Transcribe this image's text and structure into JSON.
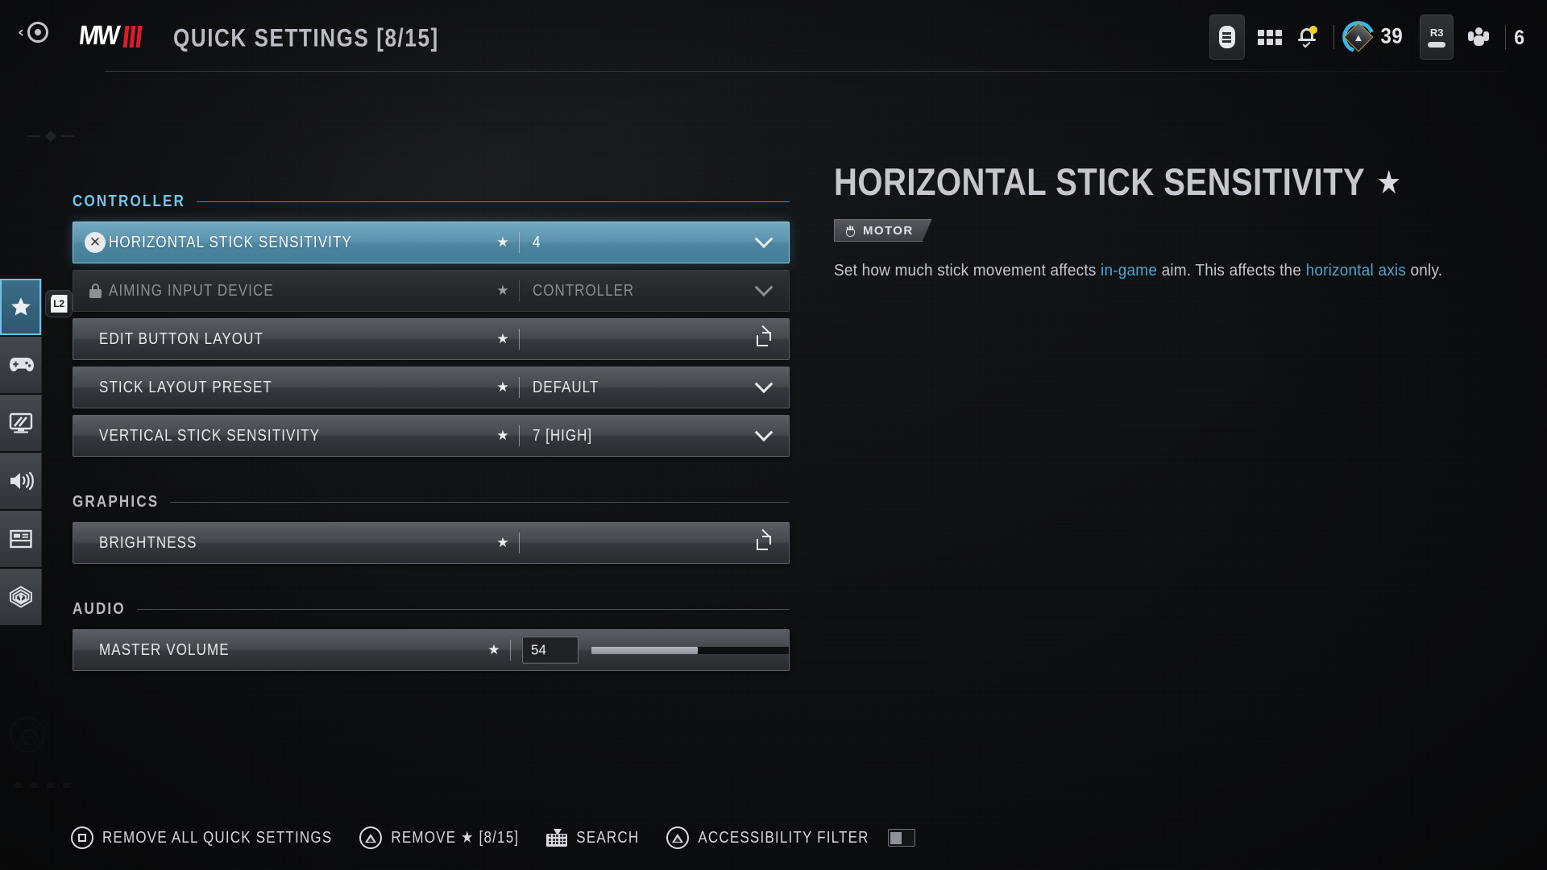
{
  "header": {
    "back_icon": "back-circle-icon",
    "logo_text": "MW",
    "logo_numeral": "III",
    "title": "QUICK SETTINGS [8/15]",
    "icons": {
      "battery": "battery-icon",
      "grid": "grid-menu-icon",
      "notifications": "bell-icon",
      "rank_emblem": "rank-emblem-icon",
      "squad": "squad-icon",
      "r3_label": "R3"
    },
    "rank_level": "39",
    "squad_count": "6"
  },
  "leftnav": {
    "trigger_hint": "L2",
    "items": [
      {
        "name": "quick-settings",
        "icon": "star-icon",
        "active": true
      },
      {
        "name": "controller",
        "icon": "gamepad-icon",
        "active": false
      },
      {
        "name": "graphics",
        "icon": "monitor-icon",
        "active": false
      },
      {
        "name": "audio",
        "icon": "speaker-icon",
        "active": false
      },
      {
        "name": "interface",
        "icon": "hud-layout-icon",
        "active": false
      },
      {
        "name": "accessibility",
        "icon": "signal-beacon-icon",
        "active": false
      }
    ]
  },
  "settings": {
    "sections": [
      {
        "label": "CONTROLLER",
        "accent": true,
        "rows": [
          {
            "name": "HORIZONTAL STICK SENSITIVITY",
            "star": "★",
            "value": "4",
            "control": "dropdown",
            "state": "selected",
            "lead_icon": "cross-button-icon"
          },
          {
            "name": "AIMING INPUT DEVICE",
            "star": "★",
            "value": "CONTROLLER",
            "control": "dropdown",
            "state": "locked",
            "lead_icon": "lock-icon"
          },
          {
            "name": "EDIT BUTTON LAYOUT",
            "star": "★",
            "value": "",
            "control": "external",
            "state": "normal",
            "lead_icon": ""
          },
          {
            "name": "STICK LAYOUT PRESET",
            "star": "★",
            "value": "DEFAULT",
            "control": "dropdown",
            "state": "normal",
            "lead_icon": ""
          },
          {
            "name": "VERTICAL STICK SENSITIVITY",
            "star": "★",
            "value": "7 [HIGH]",
            "control": "dropdown",
            "state": "normal",
            "lead_icon": ""
          }
        ]
      },
      {
        "label": "GRAPHICS",
        "accent": false,
        "rows": [
          {
            "name": "BRIGHTNESS",
            "star": "★",
            "value": "",
            "control": "external",
            "state": "normal",
            "lead_icon": ""
          }
        ]
      },
      {
        "label": "AUDIO",
        "accent": false,
        "rows": [
          {
            "name": "MASTER VOLUME",
            "star": "★",
            "value": "54",
            "control": "slider",
            "slider_percent": 54,
            "state": "normal",
            "lead_icon": ""
          }
        ]
      }
    ]
  },
  "detail": {
    "title": "HORIZONTAL STICK SENSITIVITY",
    "favorite_star": "★",
    "badge_icon": "hand-icon",
    "badge_label": "MOTOR",
    "desc_part1": "Set how much stick movement affects ",
    "desc_link1": "in-game",
    "desc_part2": " aim. This affects the ",
    "desc_link2": "horizontal axis",
    "desc_part3": " only."
  },
  "footer": {
    "buttons": [
      {
        "key": "square",
        "label": "REMOVE ALL QUICK SETTINGS"
      },
      {
        "key": "triangle",
        "label": "REMOVE ★ [8/15]"
      },
      {
        "key": "keyboard",
        "label": "SEARCH"
      },
      {
        "key": "triangle",
        "label": "ACCESSIBILITY FILTER",
        "toggle": "off"
      }
    ]
  },
  "colors": {
    "accent_blue": "#74c6ea",
    "selected_row": "#5b93ad",
    "link_blue": "#4ea3d1",
    "background": "#121316",
    "notification_dot": "#f5d11a",
    "logo_red": "#d81f26"
  }
}
